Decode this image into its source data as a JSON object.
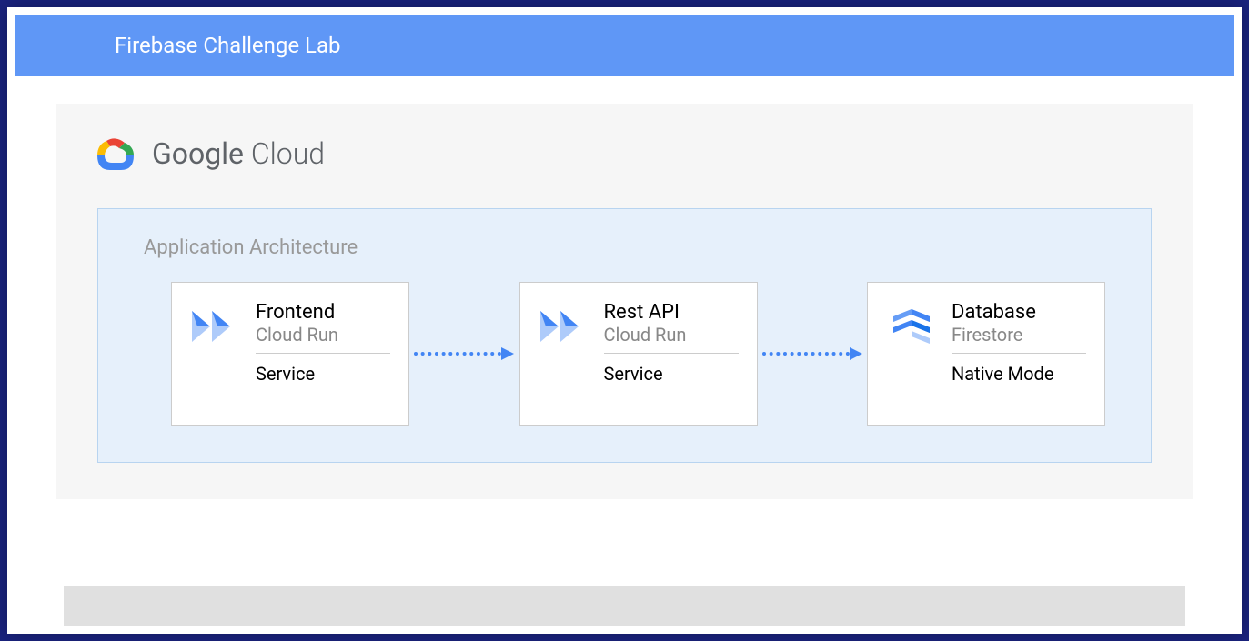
{
  "header": {
    "title": "Firebase Challenge Lab"
  },
  "cloud": {
    "name_bold": "Google",
    "name_light": " Cloud"
  },
  "architecture": {
    "title": "Application Architecture",
    "boxes": [
      {
        "title": "Frontend",
        "subtitle": "Cloud Run",
        "detail": "Service",
        "icon": "cloud-run"
      },
      {
        "title": "Rest API",
        "subtitle": "Cloud Run",
        "detail": "Service",
        "icon": "cloud-run"
      },
      {
        "title": "Database",
        "subtitle": "Firestore",
        "detail": "Native Mode",
        "icon": "firestore"
      }
    ]
  },
  "colors": {
    "header_bg": "#5f97f6",
    "arch_bg": "#e6f0fb",
    "outer_bg": "#1a237e",
    "accent": "#4285f4"
  }
}
